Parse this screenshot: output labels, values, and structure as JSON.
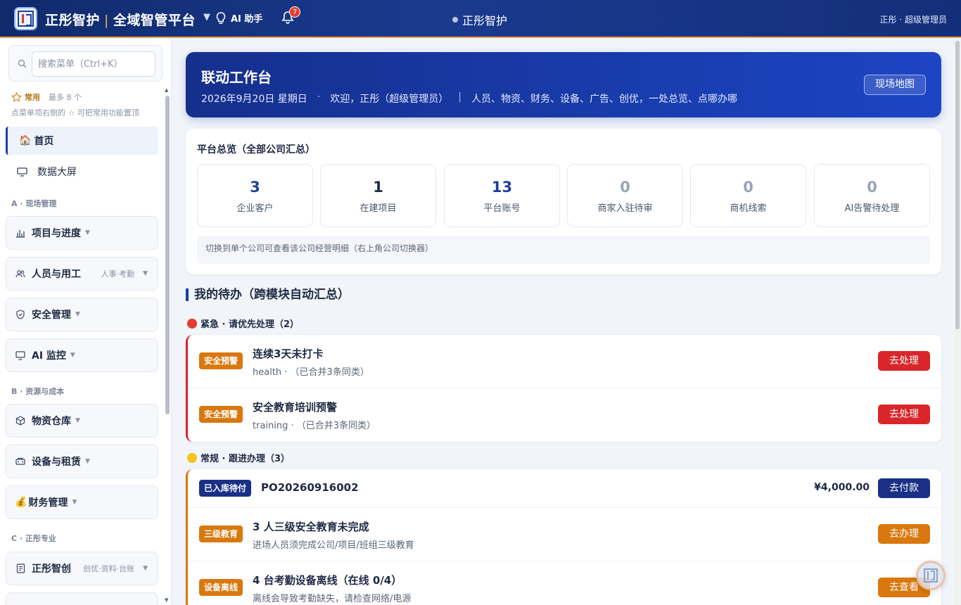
{
  "topbar": {
    "brand": "正彤智护",
    "platform": "全域智管平台",
    "ai_label": "AI 助手",
    "notification_count": "7",
    "center_title": "正彤智护",
    "user": "正彤 · 超级管理员"
  },
  "sidebar": {
    "search_placeholder": "搜索菜单（Ctrl+K）",
    "fav_label": "常用",
    "fav_limit": "最多 8 个",
    "fav_hint": "点菜单项右侧的 ☆ 可把常用功能置顶",
    "home": "首页",
    "dashboard": "数据大屏",
    "sections": {
      "a": "A · 现场管理",
      "b": "B · 资源与成本",
      "c": "C · 正彤专业"
    },
    "groups": {
      "project": "项目与进度",
      "people": "人员与用工",
      "people_tag": "人事·考勤",
      "safety": "安全管理",
      "ai_monitor": "AI 监控",
      "warehouse": "物资仓库",
      "equipment": "设备与租赁",
      "finance": "财务管理",
      "zhichuang": "正彤智创",
      "zhichuang_tag": "创优·资料·台账"
    }
  },
  "banner": {
    "title": "联动工作台",
    "date": "2026年9月20日 星期日",
    "dot": "·",
    "welcome": "欢迎，正彤（超级管理员）",
    "pipe": "|",
    "slogan": "人员、物资、财务、设备、广告、创优，一处总览、点哪办哪",
    "map_button": "现场地图"
  },
  "overview": {
    "title": "平台总览（全部公司汇总）",
    "stats": [
      {
        "value": "3",
        "label": "企业客户",
        "color": "#1f3f9e"
      },
      {
        "value": "1",
        "label": "在建项目",
        "color": "#1f2a44"
      },
      {
        "value": "13",
        "label": "平台账号",
        "color": "#1f3f9e"
      },
      {
        "value": "0",
        "label": "商家入驻待审",
        "color": "#9aa3b5"
      },
      {
        "value": "0",
        "label": "商机线索",
        "color": "#9aa3b5"
      },
      {
        "value": "0",
        "label": "AI告警待处理",
        "color": "#9aa3b5"
      }
    ],
    "note": "切换到单个公司可查看该公司经营明细（右上角公司切换器）"
  },
  "todo": {
    "title": "我的待办（跨模块自动汇总）",
    "urgent_title": "紧急 · 请优先处理（2）",
    "normal_title": "常规 · 跟进办理（3）",
    "urgent": [
      {
        "badge": "安全预警",
        "title": "连续3天未打卡",
        "sub": "health · （已合并3条同类）",
        "action": "去处理"
      },
      {
        "badge": "安全预警",
        "title": "安全教育培训预警",
        "sub": "training · （已合并3条同类）",
        "action": "去处理"
      }
    ],
    "normal": [
      {
        "badge": "已入库待付",
        "title": "PO20260916002",
        "amount": "¥4,000.00",
        "action": "去付款"
      },
      {
        "badge": "三级教育",
        "title": "3 人三级安全教育未完成",
        "sub": "进场人员须完成公司/项目/班组三级教育",
        "action": "去办理"
      },
      {
        "badge": "设备离线",
        "title": "4 台考勤设备离线（在线 0/4）",
        "sub": "离线会导致考勤缺失，请检查网络/电源",
        "action": "去查看"
      }
    ]
  },
  "colors": {
    "primary": "#1f3f9e",
    "urgent": "#d9262a",
    "warning": "#d9780e",
    "navy": "#1a2f86"
  }
}
